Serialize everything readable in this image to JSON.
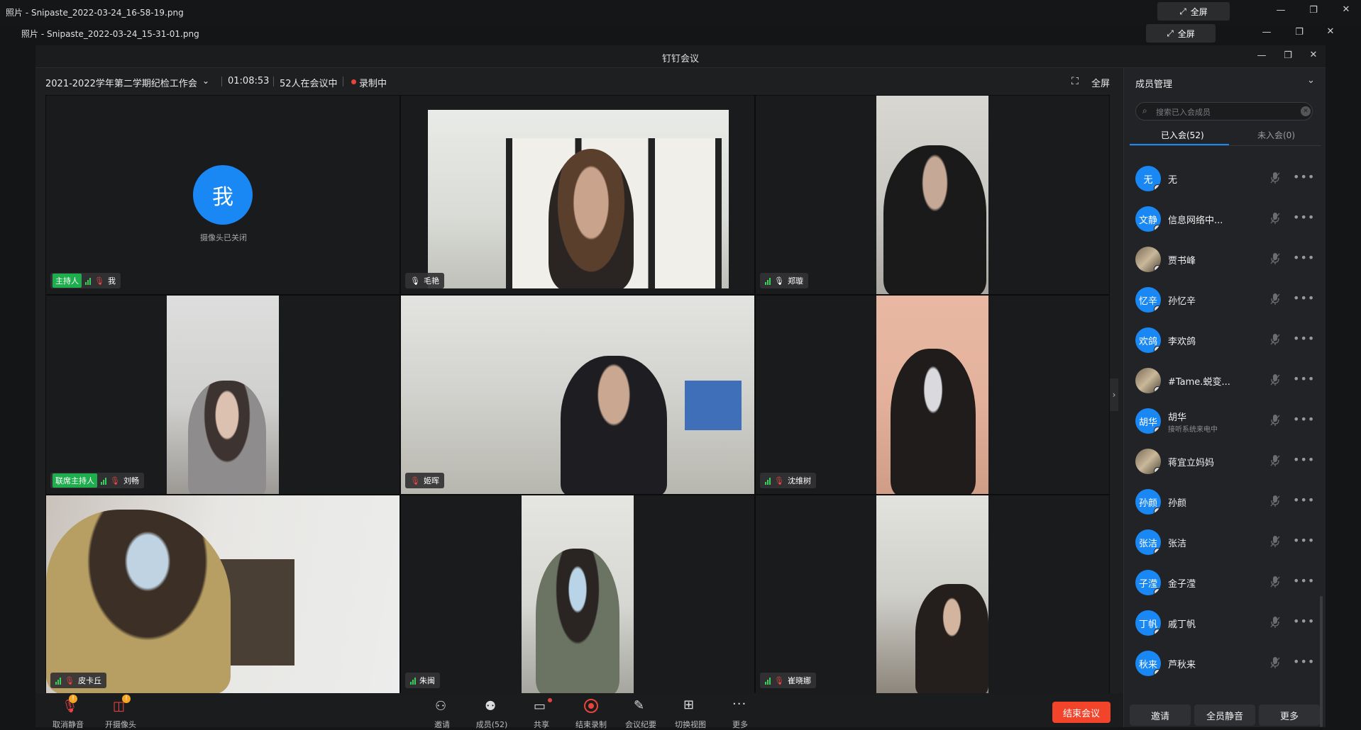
{
  "outer_window": {
    "title": "照片 - Snipaste_2022-03-24_16-58-19.png",
    "fullscreen_label": "全屏"
  },
  "inner_window": {
    "title": "照片 - Snipaste_2022-03-24_15-31-01.png",
    "fullscreen_label": "全屏"
  },
  "app": {
    "title": "钉钉会议",
    "meeting_name": "2021-2022学年第二学期纪检工作会",
    "duration": "01:08:53",
    "participants": "52人在会议中",
    "recording": "录制中",
    "fullscreen_label": "全屏"
  },
  "tiles": [
    {
      "name": "我",
      "role": "主持人",
      "camera_off": true,
      "avatar_text": "我",
      "status": "摄像头已关闭"
    },
    {
      "name": "毛艳",
      "role": ""
    },
    {
      "name": "郑璇",
      "role": ""
    },
    {
      "name": "刘畅",
      "role": "联席主持人"
    },
    {
      "name": "姬晖",
      "role": ""
    },
    {
      "name": "沈维树",
      "role": ""
    },
    {
      "name": "皮卡丘",
      "role": ""
    },
    {
      "name": "朱闽",
      "role": ""
    },
    {
      "name": "崔晓娜",
      "role": ""
    }
  ],
  "side_panel": {
    "title": "成员管理",
    "search_placeholder": "搜索已入会成员",
    "tab_joined": "已入会(52)",
    "tab_not_joined": "未入会(0)",
    "members": [
      {
        "avatar": "无",
        "name": "无",
        "sub": ""
      },
      {
        "avatar": "文静",
        "name": "信息网络中...",
        "sub": ""
      },
      {
        "avatar": "",
        "name": "贾书峰",
        "sub": "",
        "photo": true
      },
      {
        "avatar": "忆辛",
        "name": "孙忆辛",
        "sub": ""
      },
      {
        "avatar": "欢鸽",
        "name": "李欢鸽",
        "sub": ""
      },
      {
        "avatar": "",
        "name": "#Tame.蜕变...",
        "sub": "",
        "photo": true
      },
      {
        "avatar": "胡华",
        "name": "胡华",
        "sub": "接听系统来电中"
      },
      {
        "avatar": "",
        "name": "蒋宜立妈妈",
        "sub": "",
        "photo": true
      },
      {
        "avatar": "孙颜",
        "name": "孙颜",
        "sub": ""
      },
      {
        "avatar": "张洁",
        "name": "张洁",
        "sub": ""
      },
      {
        "avatar": "子滢",
        "name": "金子滢",
        "sub": ""
      },
      {
        "avatar": "丁帆",
        "name": "戚丁帆",
        "sub": ""
      },
      {
        "avatar": "秋来",
        "name": "芦秋来",
        "sub": ""
      }
    ],
    "buttons": [
      "邀请",
      "全员静音",
      "更多"
    ]
  },
  "toolbar": {
    "items": [
      "取消静音",
      "开摄像头",
      "邀请",
      "成员(52)",
      "共享",
      "结束录制",
      "会议纪要",
      "切换视图",
      "更多"
    ],
    "end_meeting": "结束会议"
  },
  "colors": {
    "accent": "#1a88f4",
    "end": "#f2432b",
    "host_badge": "#1fae4e",
    "signal": "#36d05a",
    "recording": "#e8443a"
  }
}
